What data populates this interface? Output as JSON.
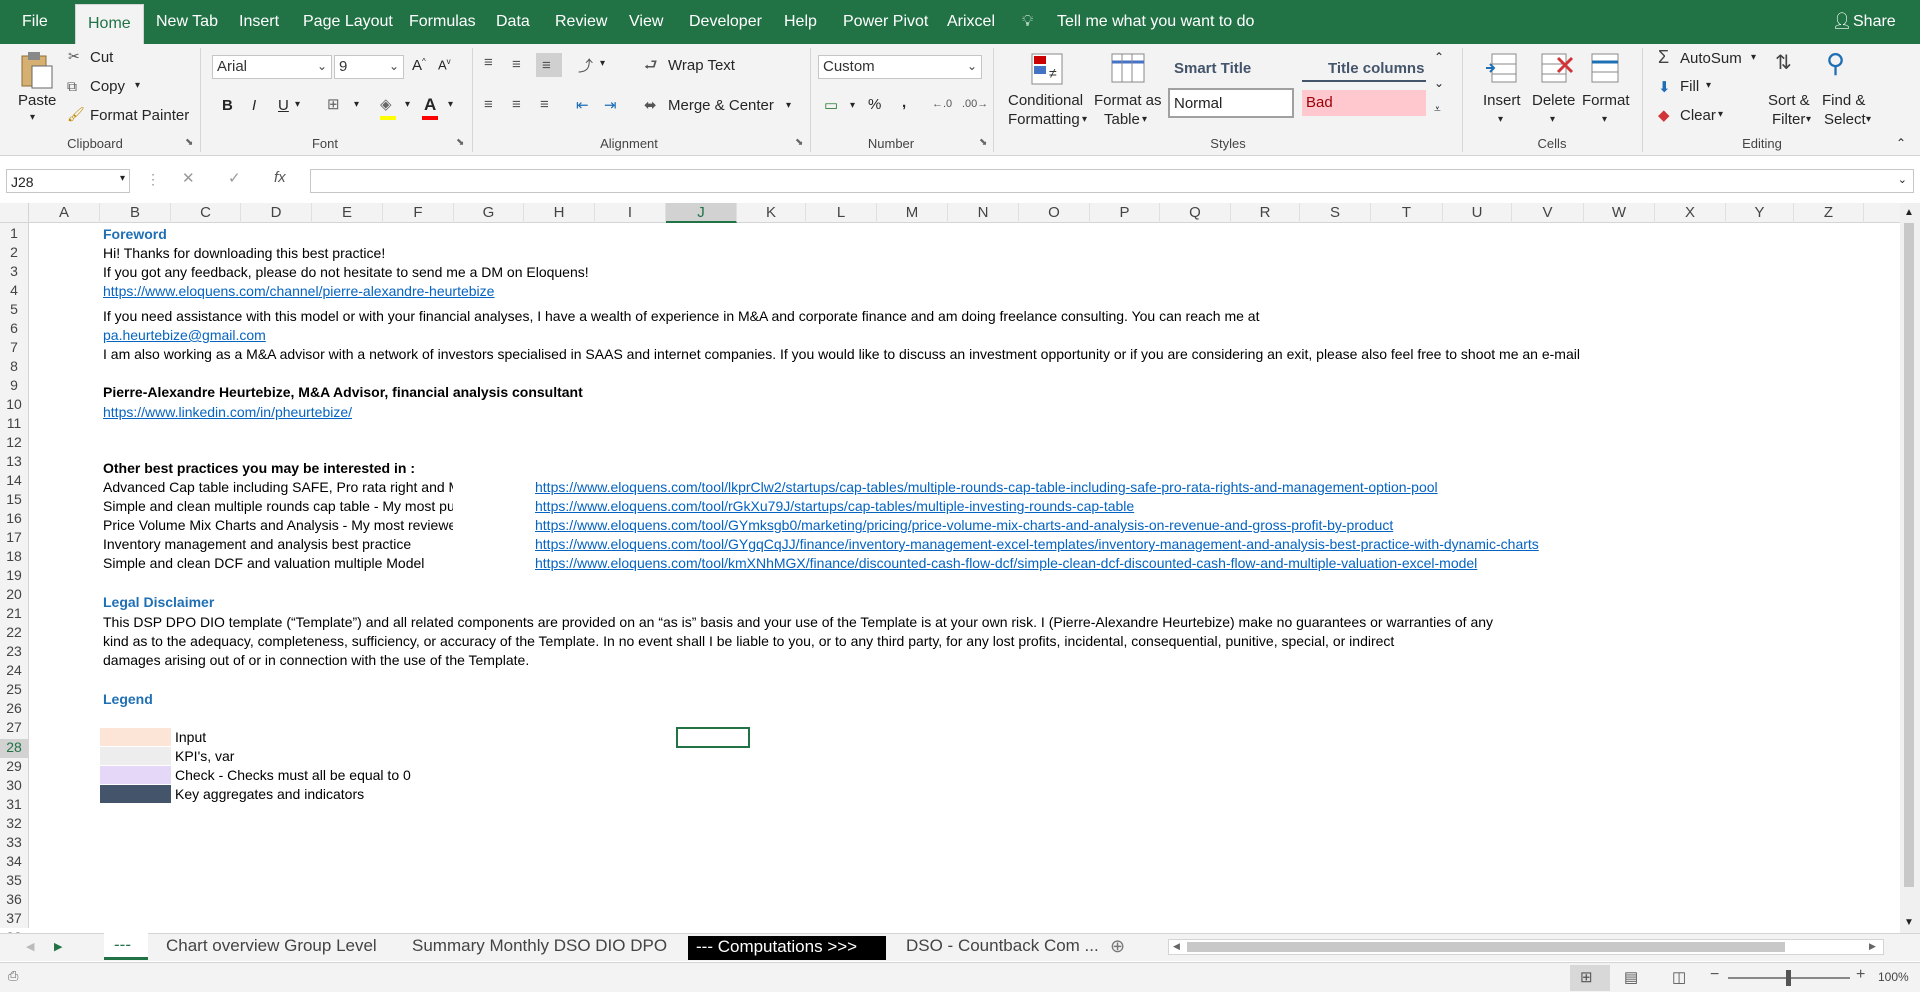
{
  "ribbon_tabs": [
    "File",
    "Home",
    "New Tab",
    "Insert",
    "Page Layout",
    "Formulas",
    "Data",
    "Review",
    "View",
    "Developer",
    "Help",
    "Power Pivot",
    "Arixcel"
  ],
  "tell_me": "Tell me what you want to do",
  "share": "Share",
  "clipboard": {
    "paste": "Paste",
    "cut": "Cut",
    "copy": "Copy",
    "format_painter": "Format Painter",
    "label": "Clipboard"
  },
  "font": {
    "name": "Arial",
    "size": "9",
    "label": "Font",
    "bold": "B",
    "italic": "I",
    "underline": "U",
    "font_color": "A"
  },
  "alignment": {
    "wrap": "Wrap Text",
    "merge": "Merge & Center",
    "label": "Alignment"
  },
  "number": {
    "format": "Custom",
    "label": "Number",
    "percent": "%",
    "comma": ","
  },
  "styles": {
    "conditional": "Conditional",
    "conditional2": "Formatting",
    "format_table": "Format as",
    "format_table2": "Table",
    "smart_title": "Smart Title",
    "title_columns": "Title columns",
    "normal": "Normal",
    "bad": "Bad",
    "label": "Styles"
  },
  "cells": {
    "insert": "Insert",
    "delete": "Delete",
    "format": "Format",
    "label": "Cells"
  },
  "editing": {
    "autosum": "AutoSum",
    "fill": "Fill",
    "clear": "Clear",
    "sort": "Sort &",
    "sort2": "Filter",
    "find": "Find &",
    "find2": "Select",
    "label": "Editing"
  },
  "name_box": "J28",
  "fx": "fx",
  "columns": [
    "A",
    "B",
    "C",
    "D",
    "E",
    "F",
    "G",
    "H",
    "I",
    "J",
    "K",
    "L",
    "M",
    "N",
    "O",
    "P",
    "Q",
    "R",
    "S",
    "T",
    "U",
    "V",
    "W",
    "X",
    "Y",
    "Z"
  ],
  "rows": [
    "1",
    "2",
    "3",
    "4",
    "5",
    "6",
    "7",
    "8",
    "9",
    "10",
    "11",
    "12",
    "13",
    "14",
    "15",
    "16",
    "17",
    "18",
    "19",
    "20",
    "21",
    "22",
    "23",
    "24",
    "25",
    "26",
    "27",
    "28",
    "29",
    "30",
    "31",
    "32",
    "33",
    "34",
    "35",
    "36",
    "37",
    "38"
  ],
  "content": {
    "foreword": "Foreword",
    "r2": "Hi! Thanks for downloading this best practice!",
    "r3": "If you got any feedback, please do not hesitate to send me a DM on Eloquens!",
    "r4": "https://www.eloquens.com/channel/pierre-alexandre-heurtebize",
    "r6": "If you need assistance with this model or with your financial analyses, I have a wealth of experience in M&A and corporate finance and am doing freelance consulting. You can reach me at",
    "r7": "pa.heurtebize@gmail.com",
    "r8": "I am also working as a M&A advisor with a network of investors specialised in SAAS and internet companies. If you would like to discuss an investment opportunity or if you are considering an exit, please also feel free to shoot me an e-mail",
    "r10": "Pierre-Alexandre Heurtebize, M&A Advisor, financial analysis consultant",
    "r11": "https://www.linkedin.com/in/pheurtebize/",
    "r14": "Other best practices you may be interested in :",
    "practices": [
      {
        "name": "Advanced Cap table including SAFE, Pro rata right and Manageme",
        "url": "https://www.eloquens.com/tool/lkprClw2/startups/cap-tables/multiple-rounds-cap-table-including-safe-pro-rata-rights-and-management-option-pool"
      },
      {
        "name": "Simple and clean multiple rounds cap table - My most purchased t",
        "url": "https://www.eloquens.com/tool/rGkXu79J/startups/cap-tables/multiple-investing-rounds-cap-table"
      },
      {
        "name": "Price Volume Mix Charts and Analysis - My most reviewed best pra",
        "url": "https://www.eloquens.com/tool/GYmksgb0/marketing/pricing/price-volume-mix-charts-and-analysis-on-revenue-and-gross-profit-by-product"
      },
      {
        "name": "Inventory management and analysis best practice",
        "url": "https://www.eloquens.com/tool/GYgqCqJJ/finance/inventory-management-excel-templates/inventory-management-and-analysis-best-practice-with-dynamic-charts"
      },
      {
        "name": "Simple and clean DCF and valuation multiple Model",
        "url": "https://www.eloquens.com/tool/kmXNhMGX/finance/discounted-cash-flow-dcf/simple-clean-dcf-discounted-cash-flow-and-multiple-valuation-excel-model"
      }
    ],
    "legal": "Legal Disclaimer",
    "r22": "This DSP DPO DIO template (“Template”) and all related components are provided on an “as is” basis and your use of the Template is at your own risk.  I (Pierre-Alexandre Heurtebize) make no guarantees or warranties of any",
    "r23": "kind as to the adequacy, completeness, sufficiency, or accuracy of the Template. In no event shall I be liable to you, or to any third party, for any lost profits, incidental, consequential, punitive, special, or indirect",
    "r24": "damages arising out of or in connection with the use of the Template.",
    "legend": "Legend",
    "legend_items": [
      {
        "label": "Input",
        "color": "#fce4d6"
      },
      {
        "label": "KPI's, var",
        "color": "#ededed"
      },
      {
        "label": "Check - Checks must all be equal to 0",
        "color": "#e4d7f7"
      },
      {
        "label": "Key aggregates and indicators",
        "color": "#44546a"
      }
    ]
  },
  "sheet_tabs": [
    "---",
    "Chart overview Group Level",
    "Summary Monthly DSO DIO DPO",
    "--- Computations >>>",
    "DSO - Countback Com ..."
  ],
  "zoom": "100%",
  "colors": {
    "excel_green": "#217346",
    "link": "#0563c1",
    "heading_blue": "#1f6fb5",
    "bad_bg": "#ffc7ce",
    "bad_fg": "#9c0006"
  }
}
